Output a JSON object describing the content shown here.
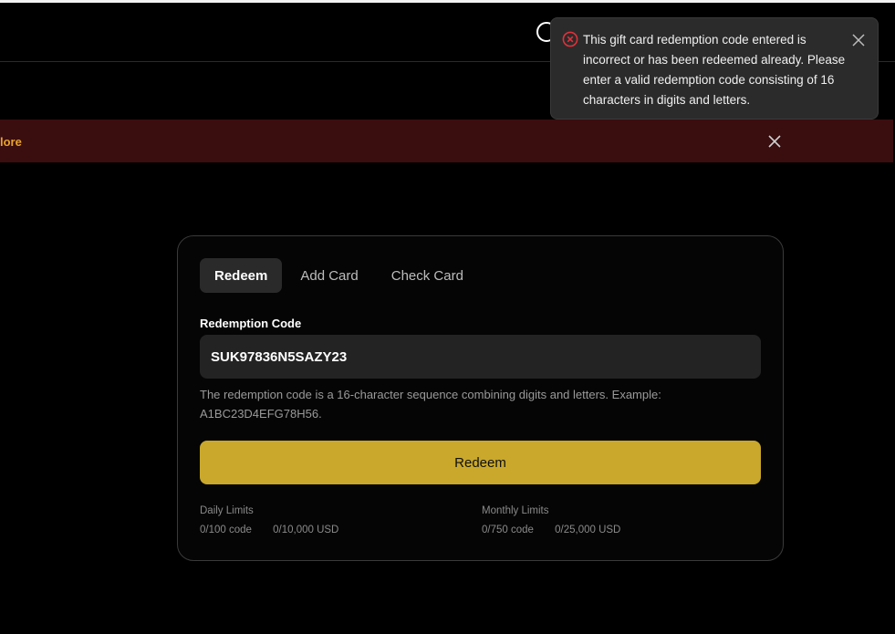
{
  "toast": {
    "message": "This gift card redemption code entered is incorrect or has been redeemed already. Please enter a valid redemption code consisting of 16 characters in digits and letters.",
    "icon": "error-circle-icon",
    "icon_color": "#e0303a"
  },
  "banner": {
    "link_text": "lore",
    "background": "#3a0d0f"
  },
  "tabs": [
    {
      "label": "Redeem",
      "active": true
    },
    {
      "label": "Add Card",
      "active": false
    },
    {
      "label": "Check Card",
      "active": false
    }
  ],
  "form": {
    "field_label": "Redemption Code",
    "code_value": "SUK97836N5SAZY23",
    "hint": "The redemption code is a 16-character sequence combining digits and letters. Example: A1BC23D4EFG78H56.",
    "submit_label": "Redeem",
    "accent": "#c9a82b"
  },
  "limits": {
    "daily": {
      "title": "Daily Limits",
      "codes": "0/100 code",
      "amount": "0/10,000 USD"
    },
    "monthly": {
      "title": "Monthly Limits",
      "codes": "0/750 code",
      "amount": "0/25,000 USD"
    }
  }
}
